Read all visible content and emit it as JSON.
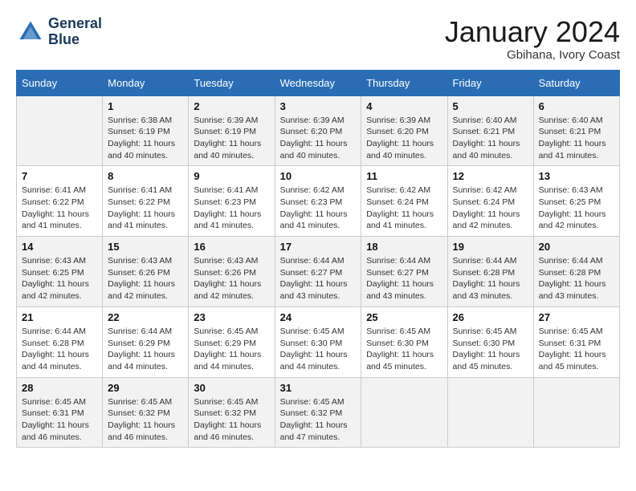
{
  "header": {
    "logo_line1": "General",
    "logo_line2": "Blue",
    "month": "January 2024",
    "location": "Gbihana, Ivory Coast"
  },
  "weekdays": [
    "Sunday",
    "Monday",
    "Tuesday",
    "Wednesday",
    "Thursday",
    "Friday",
    "Saturday"
  ],
  "weeks": [
    [
      {
        "day": "",
        "sunrise": "",
        "sunset": "",
        "daylight": ""
      },
      {
        "day": "1",
        "sunrise": "Sunrise: 6:38 AM",
        "sunset": "Sunset: 6:19 PM",
        "daylight": "Daylight: 11 hours and 40 minutes."
      },
      {
        "day": "2",
        "sunrise": "Sunrise: 6:39 AM",
        "sunset": "Sunset: 6:19 PM",
        "daylight": "Daylight: 11 hours and 40 minutes."
      },
      {
        "day": "3",
        "sunrise": "Sunrise: 6:39 AM",
        "sunset": "Sunset: 6:20 PM",
        "daylight": "Daylight: 11 hours and 40 minutes."
      },
      {
        "day": "4",
        "sunrise": "Sunrise: 6:39 AM",
        "sunset": "Sunset: 6:20 PM",
        "daylight": "Daylight: 11 hours and 40 minutes."
      },
      {
        "day": "5",
        "sunrise": "Sunrise: 6:40 AM",
        "sunset": "Sunset: 6:21 PM",
        "daylight": "Daylight: 11 hours and 40 minutes."
      },
      {
        "day": "6",
        "sunrise": "Sunrise: 6:40 AM",
        "sunset": "Sunset: 6:21 PM",
        "daylight": "Daylight: 11 hours and 41 minutes."
      }
    ],
    [
      {
        "day": "7",
        "sunrise": "Sunrise: 6:41 AM",
        "sunset": "Sunset: 6:22 PM",
        "daylight": "Daylight: 11 hours and 41 minutes."
      },
      {
        "day": "8",
        "sunrise": "Sunrise: 6:41 AM",
        "sunset": "Sunset: 6:22 PM",
        "daylight": "Daylight: 11 hours and 41 minutes."
      },
      {
        "day": "9",
        "sunrise": "Sunrise: 6:41 AM",
        "sunset": "Sunset: 6:23 PM",
        "daylight": "Daylight: 11 hours and 41 minutes."
      },
      {
        "day": "10",
        "sunrise": "Sunrise: 6:42 AM",
        "sunset": "Sunset: 6:23 PM",
        "daylight": "Daylight: 11 hours and 41 minutes."
      },
      {
        "day": "11",
        "sunrise": "Sunrise: 6:42 AM",
        "sunset": "Sunset: 6:24 PM",
        "daylight": "Daylight: 11 hours and 41 minutes."
      },
      {
        "day": "12",
        "sunrise": "Sunrise: 6:42 AM",
        "sunset": "Sunset: 6:24 PM",
        "daylight": "Daylight: 11 hours and 42 minutes."
      },
      {
        "day": "13",
        "sunrise": "Sunrise: 6:43 AM",
        "sunset": "Sunset: 6:25 PM",
        "daylight": "Daylight: 11 hours and 42 minutes."
      }
    ],
    [
      {
        "day": "14",
        "sunrise": "Sunrise: 6:43 AM",
        "sunset": "Sunset: 6:25 PM",
        "daylight": "Daylight: 11 hours and 42 minutes."
      },
      {
        "day": "15",
        "sunrise": "Sunrise: 6:43 AM",
        "sunset": "Sunset: 6:26 PM",
        "daylight": "Daylight: 11 hours and 42 minutes."
      },
      {
        "day": "16",
        "sunrise": "Sunrise: 6:43 AM",
        "sunset": "Sunset: 6:26 PM",
        "daylight": "Daylight: 11 hours and 42 minutes."
      },
      {
        "day": "17",
        "sunrise": "Sunrise: 6:44 AM",
        "sunset": "Sunset: 6:27 PM",
        "daylight": "Daylight: 11 hours and 43 minutes."
      },
      {
        "day": "18",
        "sunrise": "Sunrise: 6:44 AM",
        "sunset": "Sunset: 6:27 PM",
        "daylight": "Daylight: 11 hours and 43 minutes."
      },
      {
        "day": "19",
        "sunrise": "Sunrise: 6:44 AM",
        "sunset": "Sunset: 6:28 PM",
        "daylight": "Daylight: 11 hours and 43 minutes."
      },
      {
        "day": "20",
        "sunrise": "Sunrise: 6:44 AM",
        "sunset": "Sunset: 6:28 PM",
        "daylight": "Daylight: 11 hours and 43 minutes."
      }
    ],
    [
      {
        "day": "21",
        "sunrise": "Sunrise: 6:44 AM",
        "sunset": "Sunset: 6:28 PM",
        "daylight": "Daylight: 11 hours and 44 minutes."
      },
      {
        "day": "22",
        "sunrise": "Sunrise: 6:44 AM",
        "sunset": "Sunset: 6:29 PM",
        "daylight": "Daylight: 11 hours and 44 minutes."
      },
      {
        "day": "23",
        "sunrise": "Sunrise: 6:45 AM",
        "sunset": "Sunset: 6:29 PM",
        "daylight": "Daylight: 11 hours and 44 minutes."
      },
      {
        "day": "24",
        "sunrise": "Sunrise: 6:45 AM",
        "sunset": "Sunset: 6:30 PM",
        "daylight": "Daylight: 11 hours and 44 minutes."
      },
      {
        "day": "25",
        "sunrise": "Sunrise: 6:45 AM",
        "sunset": "Sunset: 6:30 PM",
        "daylight": "Daylight: 11 hours and 45 minutes."
      },
      {
        "day": "26",
        "sunrise": "Sunrise: 6:45 AM",
        "sunset": "Sunset: 6:30 PM",
        "daylight": "Daylight: 11 hours and 45 minutes."
      },
      {
        "day": "27",
        "sunrise": "Sunrise: 6:45 AM",
        "sunset": "Sunset: 6:31 PM",
        "daylight": "Daylight: 11 hours and 45 minutes."
      }
    ],
    [
      {
        "day": "28",
        "sunrise": "Sunrise: 6:45 AM",
        "sunset": "Sunset: 6:31 PM",
        "daylight": "Daylight: 11 hours and 46 minutes."
      },
      {
        "day": "29",
        "sunrise": "Sunrise: 6:45 AM",
        "sunset": "Sunset: 6:32 PM",
        "daylight": "Daylight: 11 hours and 46 minutes."
      },
      {
        "day": "30",
        "sunrise": "Sunrise: 6:45 AM",
        "sunset": "Sunset: 6:32 PM",
        "daylight": "Daylight: 11 hours and 46 minutes."
      },
      {
        "day": "31",
        "sunrise": "Sunrise: 6:45 AM",
        "sunset": "Sunset: 6:32 PM",
        "daylight": "Daylight: 11 hours and 47 minutes."
      },
      {
        "day": "",
        "sunrise": "",
        "sunset": "",
        "daylight": ""
      },
      {
        "day": "",
        "sunrise": "",
        "sunset": "",
        "daylight": ""
      },
      {
        "day": "",
        "sunrise": "",
        "sunset": "",
        "daylight": ""
      }
    ]
  ]
}
